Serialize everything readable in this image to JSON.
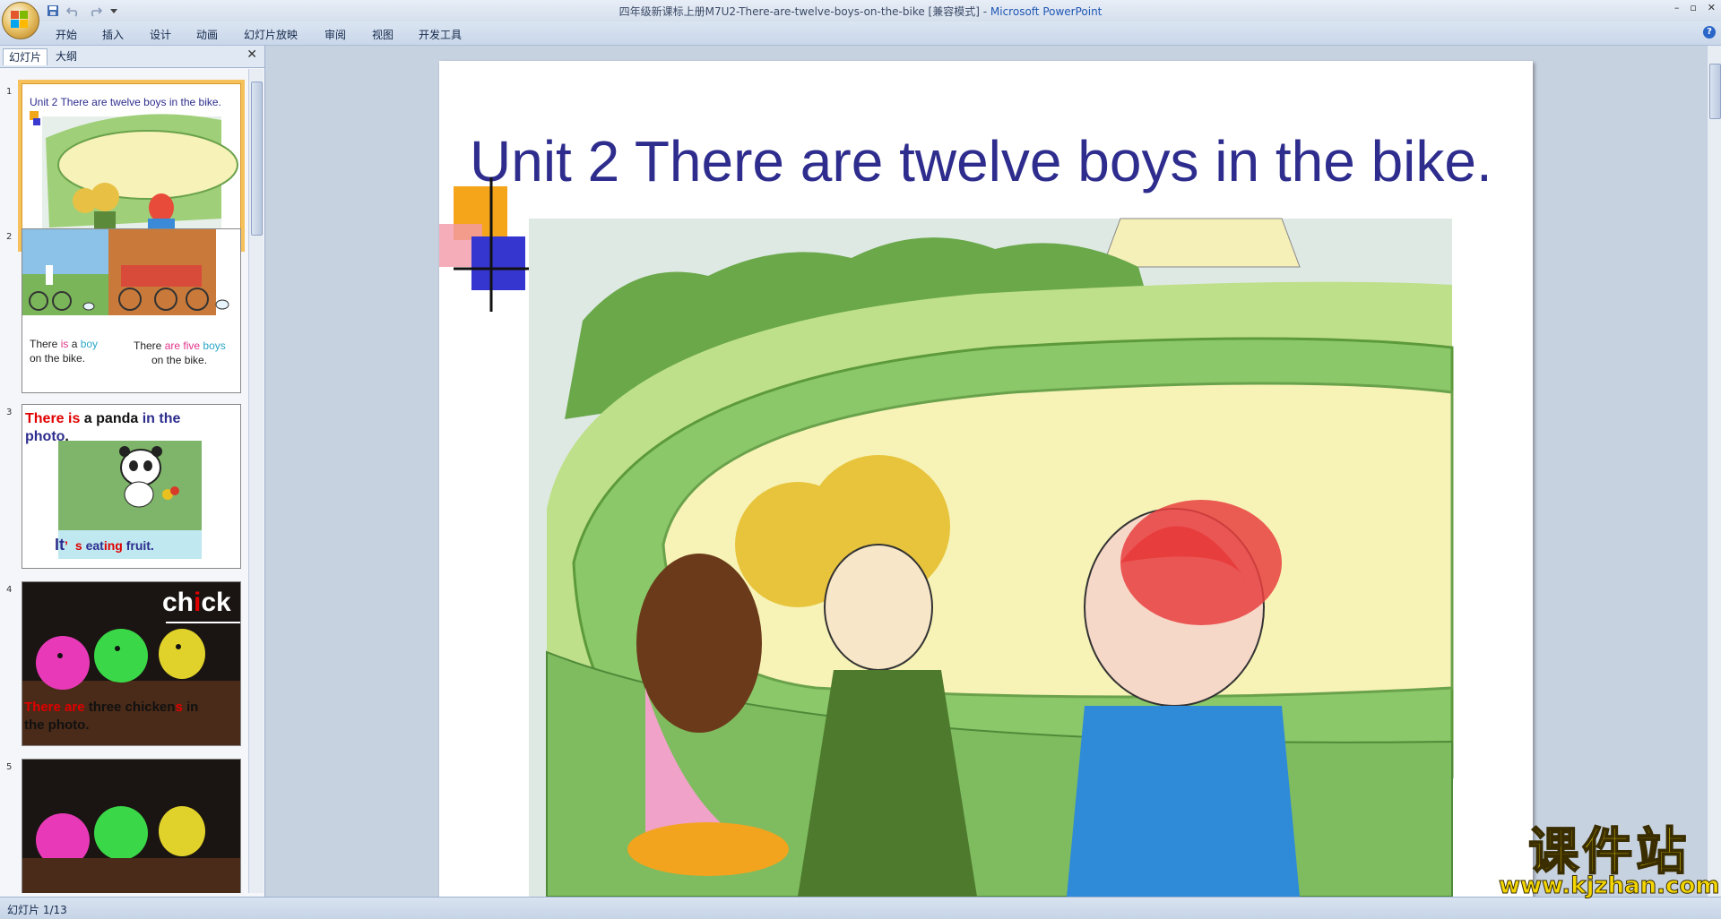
{
  "window": {
    "title": "四年级新课标上册M7U2-There-are-twelve-boys-on-the-bike [兼容模式] - ",
    "app_name": "Microsoft PowerPoint",
    "controls": [
      "–",
      "▫",
      "✕"
    ]
  },
  "ribbon": {
    "tabs": [
      "开始",
      "插入",
      "设计",
      "动画",
      "幻灯片放映",
      "审阅",
      "视图",
      "开发工具"
    ]
  },
  "panel": {
    "tabs": [
      "幻灯片",
      "大纲"
    ],
    "close": "✕"
  },
  "thumbs": {
    "nums": [
      "1",
      "2",
      "3",
      "4",
      "5"
    ],
    "t1_title": "Unit 2 There are twelve boys in the bike.",
    "t2": {
      "left_a": "There ",
      "left_b": "is",
      "left_c": " a ",
      "left_d": "boy",
      "left_e": "on the bike.",
      "right_a": "There ",
      "right_b": "are",
      "right_c": " ",
      "right_d": "five",
      "right_e": " boys",
      "right_f": "on the bike."
    },
    "t3": {
      "a": "There is",
      "b": " a panda ",
      "c": "in the",
      "d": "photo",
      "e": ".",
      "bottom_a": "It",
      "bottom_b": "’",
      "bottom_c": "s",
      "bottom_d": " eat",
      "bottom_e": "ing",
      "bottom_f": " fruit."
    },
    "t4": {
      "word_a": "ch",
      "word_b": "i",
      "word_c": "ck",
      "line_a": "There are",
      "line_b": " three chicken",
      "line_c": "s",
      "line_d": " in",
      "line_e": "the photo."
    }
  },
  "slide": {
    "title": "Unit 2 There are twelve boys in the bike."
  },
  "status": {
    "slide_indicator": "幻灯片 1/13"
  },
  "watermark": {
    "cn": "课件站",
    "url": "www.kjzhan.com"
  },
  "colors": {
    "title_blue": "#2e2d8e",
    "selected_outline": "#f6c15b",
    "app_blue": "#1f56b4"
  }
}
